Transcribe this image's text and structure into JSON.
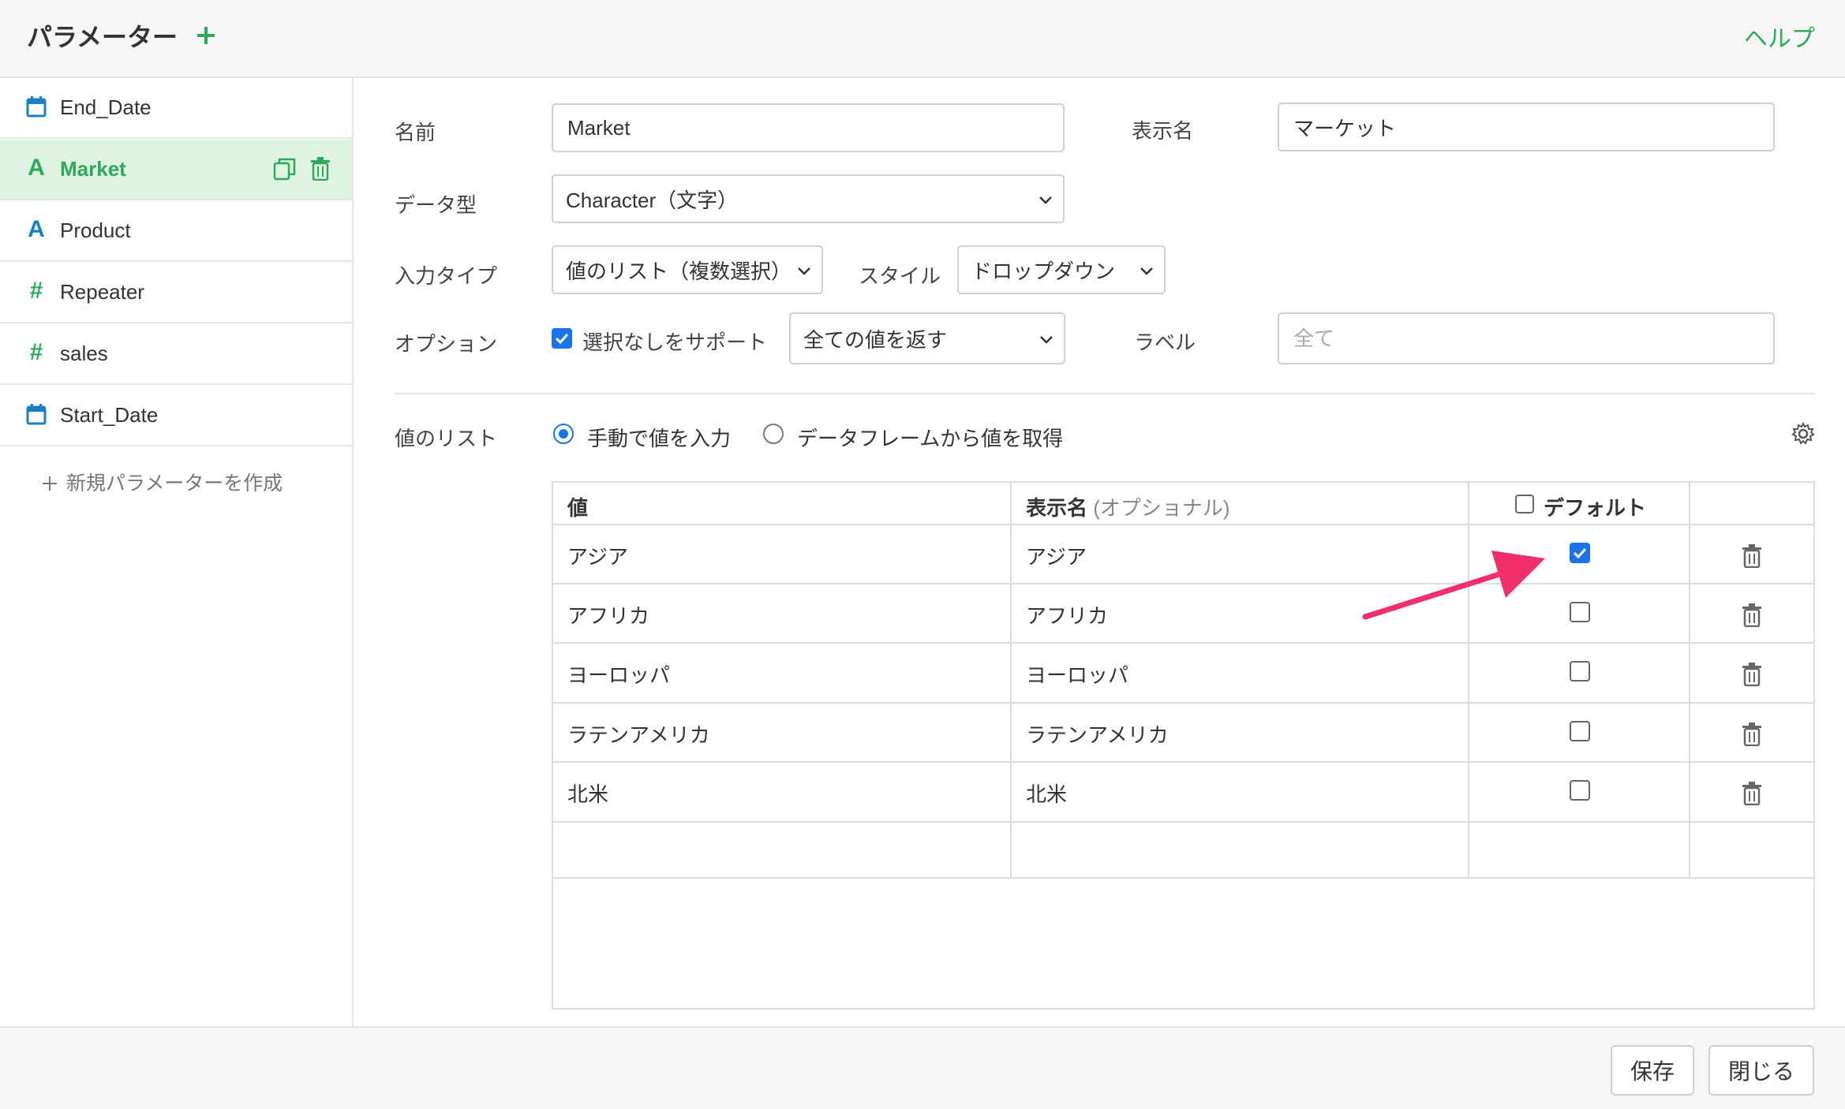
{
  "header": {
    "title": "パラメーター",
    "add_icon": "plus-icon",
    "help_label": "ヘルプ"
  },
  "sidebar": {
    "items": [
      {
        "label": "End_Date",
        "icon": "calendar-icon",
        "active": false
      },
      {
        "label": "Market",
        "icon": "letter-a-icon",
        "active": true
      },
      {
        "label": "Product",
        "icon": "letter-a-icon",
        "active": false
      },
      {
        "label": "Repeater",
        "icon": "hash-icon",
        "active": false
      },
      {
        "label": "sales",
        "icon": "hash-icon",
        "active": false
      },
      {
        "label": "Start_Date",
        "icon": "calendar-icon",
        "active": false
      }
    ],
    "new_label": "新規パラメーターを作成"
  },
  "form": {
    "name_label": "名前",
    "name_value": "Market",
    "display_name_label": "表示名",
    "display_name_value": "マーケット",
    "data_type_label": "データ型",
    "data_type_value": "Character（文字）",
    "input_type_label": "入力タイプ",
    "input_type_value": "値のリスト（複数選択）",
    "style_label": "スタイル",
    "style_value": "ドロップダウン",
    "option_label": "オプション",
    "support_none_label": "選択なしをサポート",
    "support_none_checked": true,
    "return_value": "全ての値を返す",
    "label_label": "ラベル",
    "label_placeholder": "全て",
    "value_list_label": "値のリスト",
    "radio_manual_label": "手動で値を入力",
    "radio_dataframe_label": "データフレームから値を取得",
    "radio_selected": "manual"
  },
  "table": {
    "col_value": "値",
    "col_display": "表示名",
    "col_display_optional": "(オプショナル)",
    "col_default": "デフォルト",
    "rows": [
      {
        "value": "アジア",
        "display": "アジア",
        "default": true
      },
      {
        "value": "アフリカ",
        "display": "アフリカ",
        "default": false
      },
      {
        "value": "ヨーロッパ",
        "display": "ヨーロッパ",
        "default": false
      },
      {
        "value": "ラテンアメリカ",
        "display": "ラテンアメリカ",
        "default": false
      },
      {
        "value": "北米",
        "display": "北米",
        "default": false
      }
    ]
  },
  "footer": {
    "save_label": "保存",
    "close_label": "閉じる"
  },
  "colors": {
    "accent_green": "#2fa85b",
    "active_bg": "#dff3e3",
    "checkbox_blue": "#1a73e8",
    "arrow_pink": "#f0306a"
  }
}
